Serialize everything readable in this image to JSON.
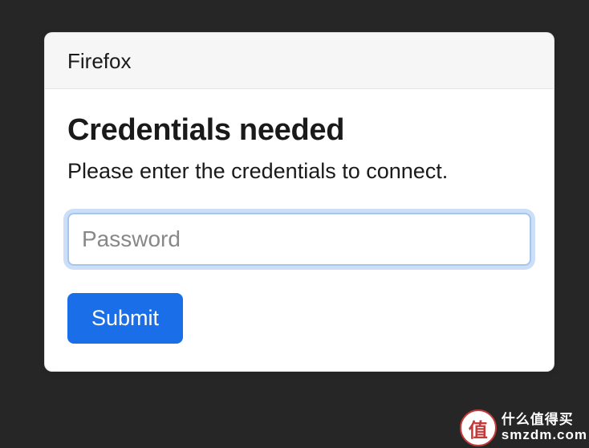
{
  "dialog": {
    "title": "Firefox",
    "heading": "Credentials needed",
    "description": "Please enter the credentials to connect.",
    "password_placeholder": "Password",
    "password_value": "",
    "submit_label": "Submit"
  },
  "watermark": {
    "badge": "值",
    "line1": "什么值得买",
    "line2": "smzdm.com"
  }
}
